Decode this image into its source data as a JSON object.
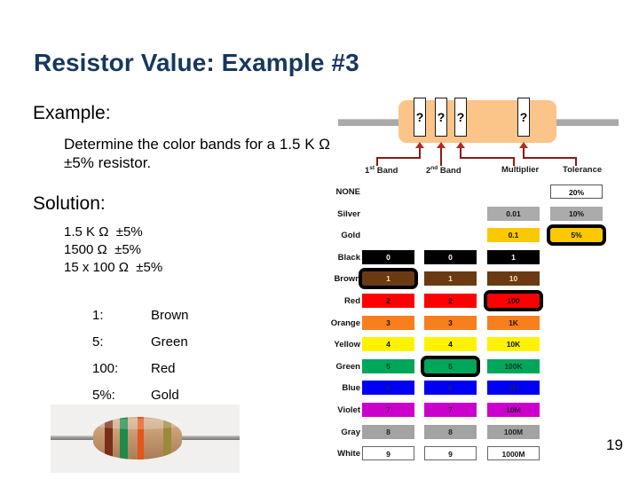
{
  "slide": {
    "title": "Resistor Value: Example #3",
    "page_number": "19"
  },
  "left_column": {
    "example_heading": "Example:",
    "example_body": "Determine the color bands for a 1.5 K Ω  ±5% resistor.",
    "solution_heading": "Solution:",
    "solution_lines": [
      "1.5 K Ω  ±5%",
      "1500 Ω  ±5%",
      "15 x 100 Ω  ±5%"
    ],
    "solution_map": [
      {
        "key": "1:",
        "value": "Brown"
      },
      {
        "key": "5:",
        "value": "Green"
      },
      {
        "key": "100:",
        "value": "Red"
      },
      {
        "key": "5%:",
        "value": "Gold"
      }
    ]
  },
  "photo": {
    "caption": "",
    "band_colors": [
      "#7a2e1a",
      "#1f8a4c",
      "#e3561c",
      "#9c8a3c"
    ],
    "body_color": "#c79a73"
  },
  "schematic": {
    "band_marks": [
      "?",
      "?",
      "?",
      "?"
    ],
    "body_color": "#FBC489",
    "lead_color": "#A9A9A9",
    "arrow_color": "#B52A20",
    "labels": [
      {
        "prefix": "1",
        "sup": "st",
        "suffix": " Band"
      },
      {
        "prefix": "2",
        "sup": "nd",
        "suffix": " Band"
      },
      {
        "prefix": "Multiplier",
        "sup": "",
        "suffix": ""
      },
      {
        "prefix": "Tolerance",
        "sup": "",
        "suffix": ""
      }
    ]
  },
  "code_table": {
    "columns": [
      "1st Band",
      "2nd Band",
      "Multiplier",
      "Tolerance"
    ],
    "rows": [
      {
        "name": "NONE",
        "swatch": "none",
        "band1": "",
        "band2": "",
        "multiplier": "",
        "tolerance": "20%",
        "highlight": ""
      },
      {
        "name": "Silver",
        "swatch": "silver",
        "band1": "",
        "band2": "",
        "multiplier": "0.01",
        "tolerance": "10%",
        "highlight": ""
      },
      {
        "name": "Gold",
        "swatch": "gold",
        "band1": "",
        "band2": "",
        "multiplier": "0.1",
        "tolerance": "5%",
        "highlight": "tolerance"
      },
      {
        "name": "Black",
        "swatch": "black",
        "band1": "0",
        "band2": "0",
        "multiplier": "1",
        "tolerance": "",
        "highlight": ""
      },
      {
        "name": "Brown",
        "swatch": "brown",
        "band1": "1",
        "band2": "1",
        "multiplier": "10",
        "tolerance": "",
        "highlight": "band1"
      },
      {
        "name": "Red",
        "swatch": "red",
        "band1": "2",
        "band2": "2",
        "multiplier": "100",
        "tolerance": "",
        "highlight": "multiplier"
      },
      {
        "name": "Orange",
        "swatch": "orange",
        "band1": "3",
        "band2": "3",
        "multiplier": "1K",
        "tolerance": "",
        "highlight": ""
      },
      {
        "name": "Yellow",
        "swatch": "yellow",
        "band1": "4",
        "band2": "4",
        "multiplier": "10K",
        "tolerance": "",
        "highlight": ""
      },
      {
        "name": "Green",
        "swatch": "green",
        "band1": "5",
        "band2": "5",
        "multiplier": "100K",
        "tolerance": "",
        "highlight": "band2"
      },
      {
        "name": "Blue",
        "swatch": "blue",
        "band1": "6",
        "band2": "6",
        "multiplier": "1M",
        "tolerance": "",
        "highlight": ""
      },
      {
        "name": "Violet",
        "swatch": "violet",
        "band1": "7",
        "band2": "7",
        "multiplier": "10M",
        "tolerance": "",
        "highlight": ""
      },
      {
        "name": "Gray",
        "swatch": "gray",
        "band1": "8",
        "band2": "8",
        "multiplier": "100M",
        "tolerance": "",
        "highlight": ""
      },
      {
        "name": "White",
        "swatch": "white",
        "band1": "9",
        "band2": "9",
        "multiplier": "1000M",
        "tolerance": "",
        "highlight": ""
      }
    ]
  },
  "colors": {
    "title": "#17375E",
    "text": "#000000",
    "background": "#FFFFFF"
  }
}
